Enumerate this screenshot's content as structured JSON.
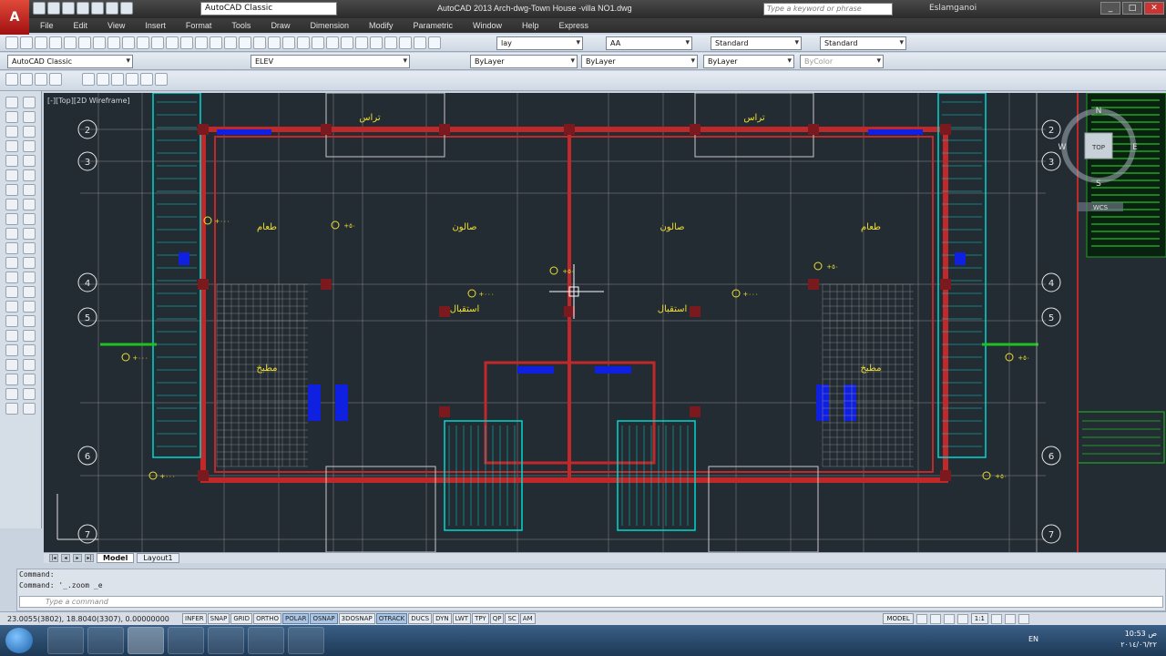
{
  "app": {
    "title": "AutoCAD 2013   Arch-dwg-Town House -villa NO1.dwg",
    "workspace": "AutoCAD Classic",
    "search_placeholder": "Type a keyword or phrase",
    "user": "Eslamganoi"
  },
  "menu": [
    "File",
    "Edit",
    "View",
    "Insert",
    "Format",
    "Tools",
    "Draw",
    "Dimension",
    "Modify",
    "Parametric",
    "Window",
    "Help",
    "Express"
  ],
  "toolbar1": {
    "text_style": "lay",
    "dim_style": "AA",
    "table_style": "Standard",
    "mleader_style": "Standard"
  },
  "toolbar2": {
    "workspace": "AutoCAD Classic",
    "layer": "ELEV",
    "color": "ByLayer",
    "linetype": "ByLayer",
    "lineweight": "ByLayer",
    "plotstyle": "ByColor"
  },
  "viewport": {
    "label": "[-][Top][2D Wireframe]"
  },
  "viewcube": {
    "top": "TOP",
    "n": "N",
    "s": "S",
    "w": "W",
    "e": "E",
    "wcs": "WCS"
  },
  "drawing": {
    "room_labels": [
      "طعام",
      "صالون",
      "صالون",
      "طعام",
      "استقبال",
      "استقبال",
      "مطبخ",
      "مطبخ",
      "تراس",
      "تراس"
    ],
    "left_axes": [
      "2",
      "3",
      "4",
      "5",
      "6",
      "7"
    ],
    "right_axes": [
      "2",
      "3",
      "4",
      "5",
      "6",
      "7"
    ],
    "levels": [
      "+٠٠٠",
      "+٥٠"
    ]
  },
  "tabs": [
    "Model",
    "Layout1"
  ],
  "command": {
    "line1": "Command:",
    "line2": "Command:  '_.zoom _e",
    "prompt": "Type a command"
  },
  "status": {
    "coords": "23.0055(3802), 18.8040(3307), 0.00000000",
    "toggles": [
      {
        "label": "INFER",
        "on": false
      },
      {
        "label": "SNAP",
        "on": false
      },
      {
        "label": "GRID",
        "on": false
      },
      {
        "label": "ORTHO",
        "on": false
      },
      {
        "label": "POLAR",
        "on": true
      },
      {
        "label": "OSNAP",
        "on": true
      },
      {
        "label": "3DOSNAP",
        "on": false
      },
      {
        "label": "OTRACK",
        "on": true
      },
      {
        "label": "DUCS",
        "on": false
      },
      {
        "label": "DYN",
        "on": false
      },
      {
        "label": "LWT",
        "on": false
      },
      {
        "label": "TPY",
        "on": false
      },
      {
        "label": "QP",
        "on": false
      },
      {
        "label": "SC",
        "on": false
      },
      {
        "label": "AM",
        "on": false
      }
    ],
    "model": "MODEL",
    "scale": "1:1"
  },
  "taskbar": {
    "lang": "EN",
    "time": "10:53 ص",
    "date": "٢٠١٤/٠٦/٢٢"
  },
  "colors": {
    "canvas": "#232b33",
    "wall": "#c0282a",
    "grid": "#e8e8e8",
    "text": "#f0e030",
    "cyan": "#00d8d0",
    "blue": "#1020e0",
    "green": "#20c020"
  }
}
